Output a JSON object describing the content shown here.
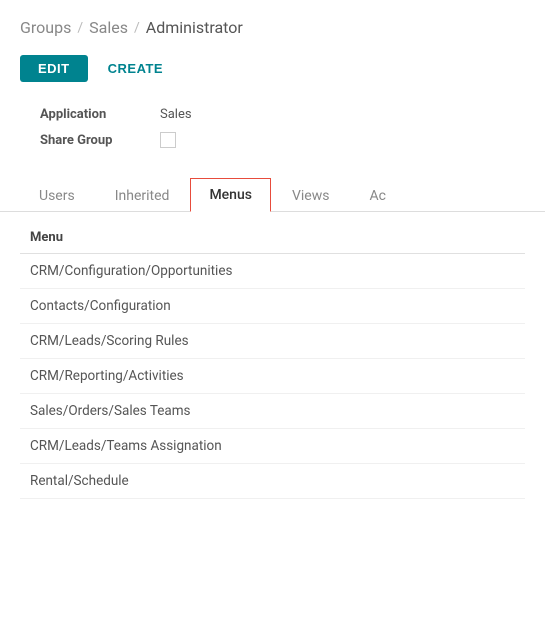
{
  "breadcrumb": {
    "items": [
      {
        "label": "Groups",
        "active": false
      },
      {
        "label": "Sales",
        "active": false
      },
      {
        "label": "Administrator",
        "active": true
      }
    ],
    "separator": "/"
  },
  "toolbar": {
    "edit_label": "EDIT",
    "create_label": "CReatE"
  },
  "form": {
    "rows": [
      {
        "label": "Application",
        "value": "Sales",
        "type": "text"
      },
      {
        "label": "Share Group",
        "value": "",
        "type": "checkbox"
      }
    ]
  },
  "tabs": [
    {
      "label": "Users",
      "active": false
    },
    {
      "label": "Inherited",
      "active": false
    },
    {
      "label": "Menus",
      "active": true
    },
    {
      "label": "Views",
      "active": false
    },
    {
      "label": "Ac",
      "active": false
    }
  ],
  "table": {
    "column_header": "Menu",
    "rows": [
      {
        "value": "CRM/Configuration/Opportunities"
      },
      {
        "value": "Contacts/Configuration"
      },
      {
        "value": "CRM/Leads/Scoring Rules"
      },
      {
        "value": "CRM/Reporting/Activities"
      },
      {
        "value": "Sales/Orders/Sales Teams"
      },
      {
        "value": "CRM/Leads/Teams Assignation"
      },
      {
        "value": "Rental/Schedule"
      }
    ]
  }
}
